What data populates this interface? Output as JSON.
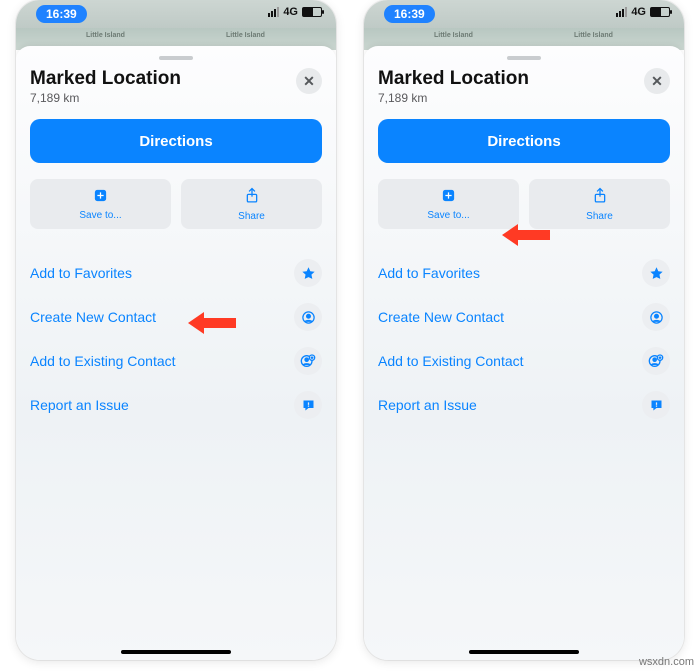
{
  "statusbar": {
    "time": "16:39",
    "network": "4G"
  },
  "map": {
    "label1": "Little Island",
    "label2": "Little Island"
  },
  "sheet": {
    "title": "Marked Location",
    "subtitle": "7,189 km",
    "directions": "Directions",
    "save": "Save to...",
    "share": "Share"
  },
  "rows": {
    "favorites": "Add to Favorites",
    "newContact": "Create New Contact",
    "existingContact": "Add to Existing Contact",
    "report": "Report an Issue"
  },
  "watermark": "wsxdn.com"
}
